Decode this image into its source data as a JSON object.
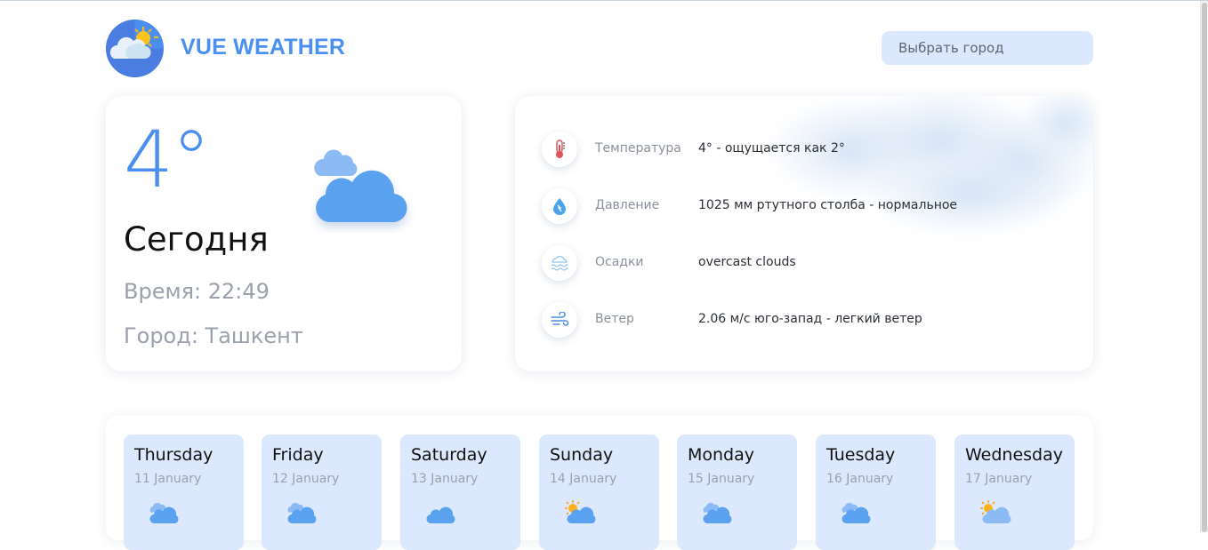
{
  "app": {
    "title": "VUE WEATHER",
    "city_placeholder": "Выбрать город",
    "logo_icon": "sun-cloud-logo-icon"
  },
  "today": {
    "temperature": "4°",
    "label": "Сегодня",
    "time": "Время: 22:49",
    "city": "Город: Ташкент",
    "icon": "broken-clouds-icon"
  },
  "details": [
    {
      "icon": "thermometer-icon",
      "label": "Температура",
      "value": "4° - ощущается как 2°"
    },
    {
      "icon": "water-drop-icon",
      "label": "Давление",
      "value": "1025 мм ртутного столба - нормальное"
    },
    {
      "icon": "precipitation-icon",
      "label": "Осадки",
      "value": "overcast clouds"
    },
    {
      "icon": "wind-icon",
      "label": "Ветер",
      "value": "2.06 м/с юго-запад - легкий ветер"
    }
  ],
  "forecast": [
    {
      "day": "Thursday",
      "date": "11 January",
      "icon": "clouds-icon"
    },
    {
      "day": "Friday",
      "date": "12 January",
      "icon": "clouds-icon"
    },
    {
      "day": "Saturday",
      "date": "13 January",
      "icon": "cloud-icon"
    },
    {
      "day": "Sunday",
      "date": "14 January",
      "icon": "sun-cloud-icon"
    },
    {
      "day": "Monday",
      "date": "15 January",
      "icon": "clouds-icon"
    },
    {
      "day": "Tuesday",
      "date": "16 January",
      "icon": "clouds-icon"
    },
    {
      "day": "Wednesday",
      "date": "17 January",
      "icon": "sun-cloud-icon"
    }
  ],
  "colors": {
    "accent": "#4a8ff0",
    "card_blue": "#dbe8fd",
    "muted_text": "#9aa1ab"
  }
}
